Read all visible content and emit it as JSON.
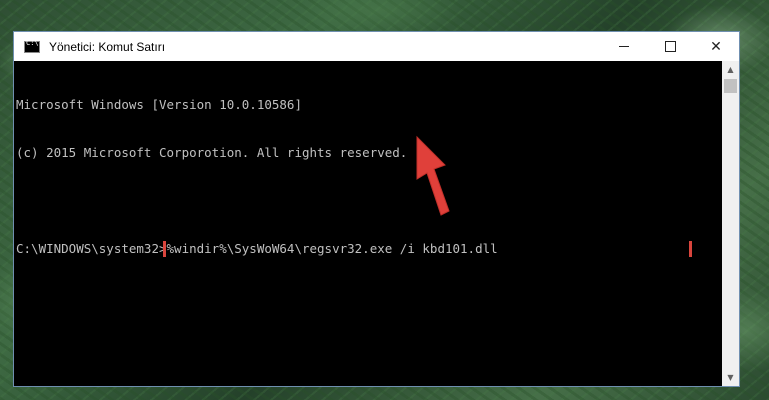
{
  "window": {
    "title": "Yönetici: Komut Satırı",
    "controls": {
      "minimize": "minimize",
      "maximize": "maximize",
      "close": "✕"
    }
  },
  "console": {
    "lines": [
      "Microsoft Windows [Version 10.0.10586]",
      "(c) 2015 Microsoft Corporotion. All rights reserved.",
      ""
    ],
    "prompt": "C:\\WINDOWS\\system32>",
    "command": "%windir%\\SysWoW64\\regsvr32.exe /i kbd101.dll"
  },
  "colors": {
    "highlight_border": "#d9453d",
    "arrow": "#e0403a",
    "console_text": "#c0c0c0",
    "console_bg": "#000000"
  },
  "icons": {
    "app": "cmd-icon",
    "annotation": "red-arrow-icon"
  }
}
